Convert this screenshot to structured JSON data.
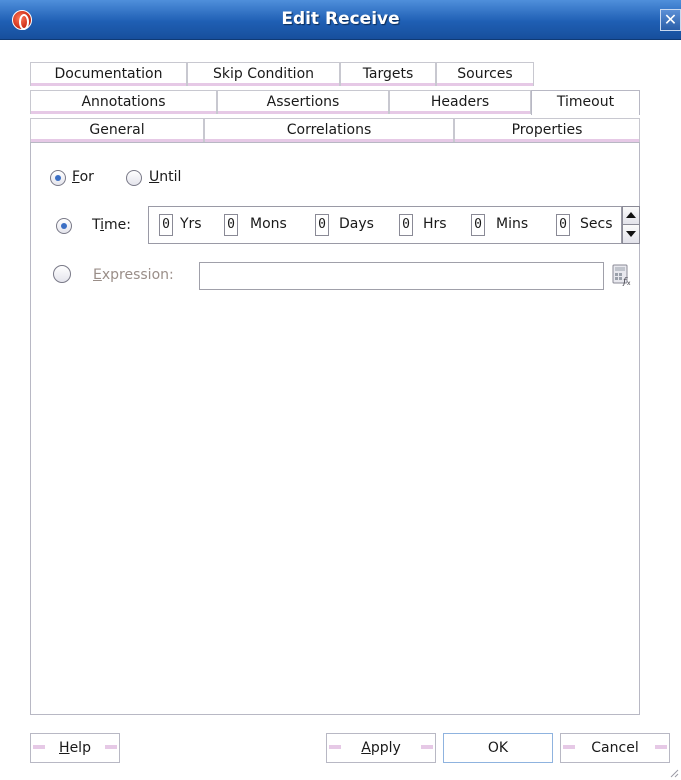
{
  "window": {
    "title": "Edit Receive",
    "close_label": "✕"
  },
  "tabs": {
    "row1": [
      "Documentation",
      "Skip Condition",
      "Targets",
      "Sources"
    ],
    "row2": [
      "Annotations",
      "Assertions",
      "Headers",
      "Timeout"
    ],
    "row3": [
      "General",
      "Correlations",
      "Properties"
    ],
    "active": "Timeout"
  },
  "timeout": {
    "mode_for": {
      "prefix": "",
      "mnemonic": "F",
      "rest": "or",
      "selected": true
    },
    "mode_until": {
      "prefix": "",
      "mnemonic": "U",
      "rest": "ntil",
      "selected": false
    },
    "time": {
      "prefix": "T",
      "mnemonic": "i",
      "rest": "me:",
      "selected": true
    },
    "fields": [
      {
        "value": "0",
        "unit": "Yrs"
      },
      {
        "value": "0",
        "unit": "Mons"
      },
      {
        "value": "0",
        "unit": "Days"
      },
      {
        "value": "0",
        "unit": "Hrs"
      },
      {
        "value": "0",
        "unit": "Mins"
      },
      {
        "value": "0",
        "unit": "Secs"
      }
    ],
    "expression": {
      "prefix": "",
      "mnemonic": "E",
      "rest": "xpression:",
      "selected": false,
      "value": ""
    }
  },
  "buttons": {
    "help": {
      "mnemonic": "H",
      "rest": "elp"
    },
    "apply": {
      "mnemonic": "A",
      "rest": "pply"
    },
    "ok": {
      "label": "OK"
    },
    "cancel": {
      "label": "Cancel"
    }
  },
  "colors": {
    "titlebar": "#1f5fb4",
    "tab_accent": "#e6c9e6",
    "radio_dot": "#3b6fc4"
  }
}
